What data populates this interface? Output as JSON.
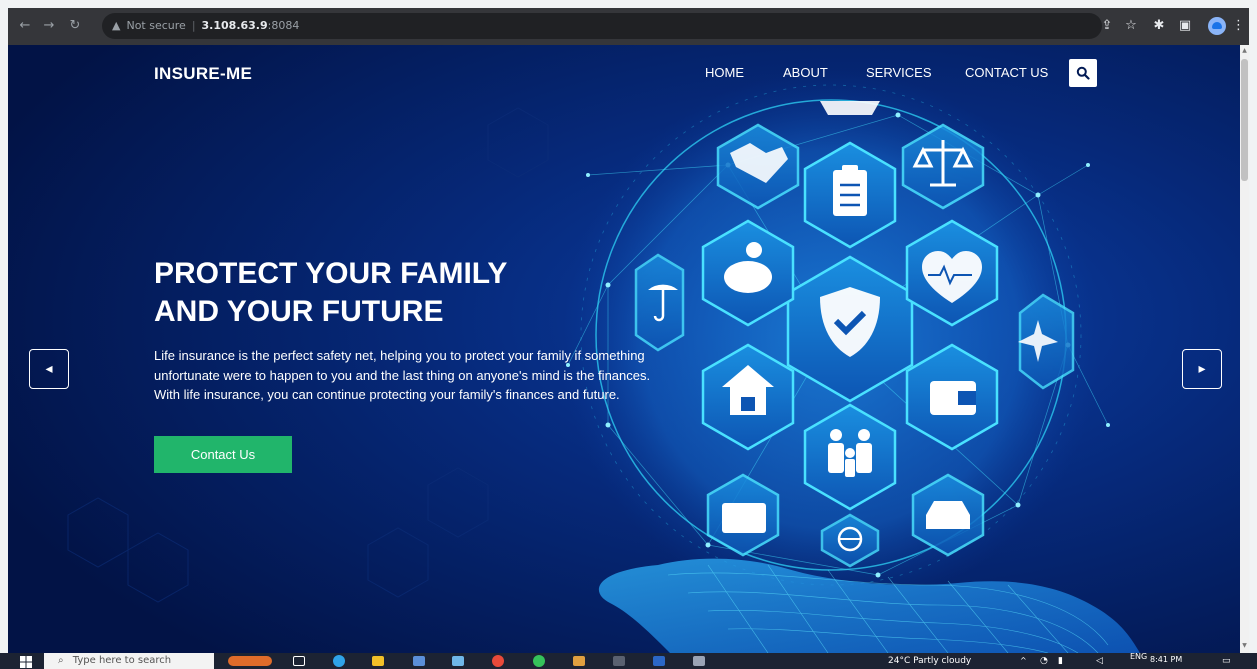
{
  "browser": {
    "security_label": "Not secure",
    "url_host": "3.108.63.9",
    "url_port": ":8084"
  },
  "site": {
    "logo": "INSURE-ME",
    "nav": [
      "HOME",
      "ABOUT",
      "SERVICES",
      "CONTACT US"
    ]
  },
  "hero": {
    "title_line1": "PROTECT YOUR FAMILY",
    "title_line2": "AND YOUR FUTURE",
    "body": "Life insurance is the perfect safety net, helping you to protect your family if something unfortunate were to happen to you and the last thing on anyone's mind is the finances. With life insurance, you can continue protecting your family's finances and future.",
    "cta_label": "Contact Us"
  },
  "taskbar": {
    "search_placeholder": "Type here to search",
    "weather": "24°C  Partly cloudy",
    "language": "ENG",
    "time": "8:41 PM"
  },
  "colors": {
    "background": "#031a55",
    "accent_green": "#21b56b",
    "globe_cyan": "#2ed3f5",
    "chrome_dark": "#35363a"
  }
}
